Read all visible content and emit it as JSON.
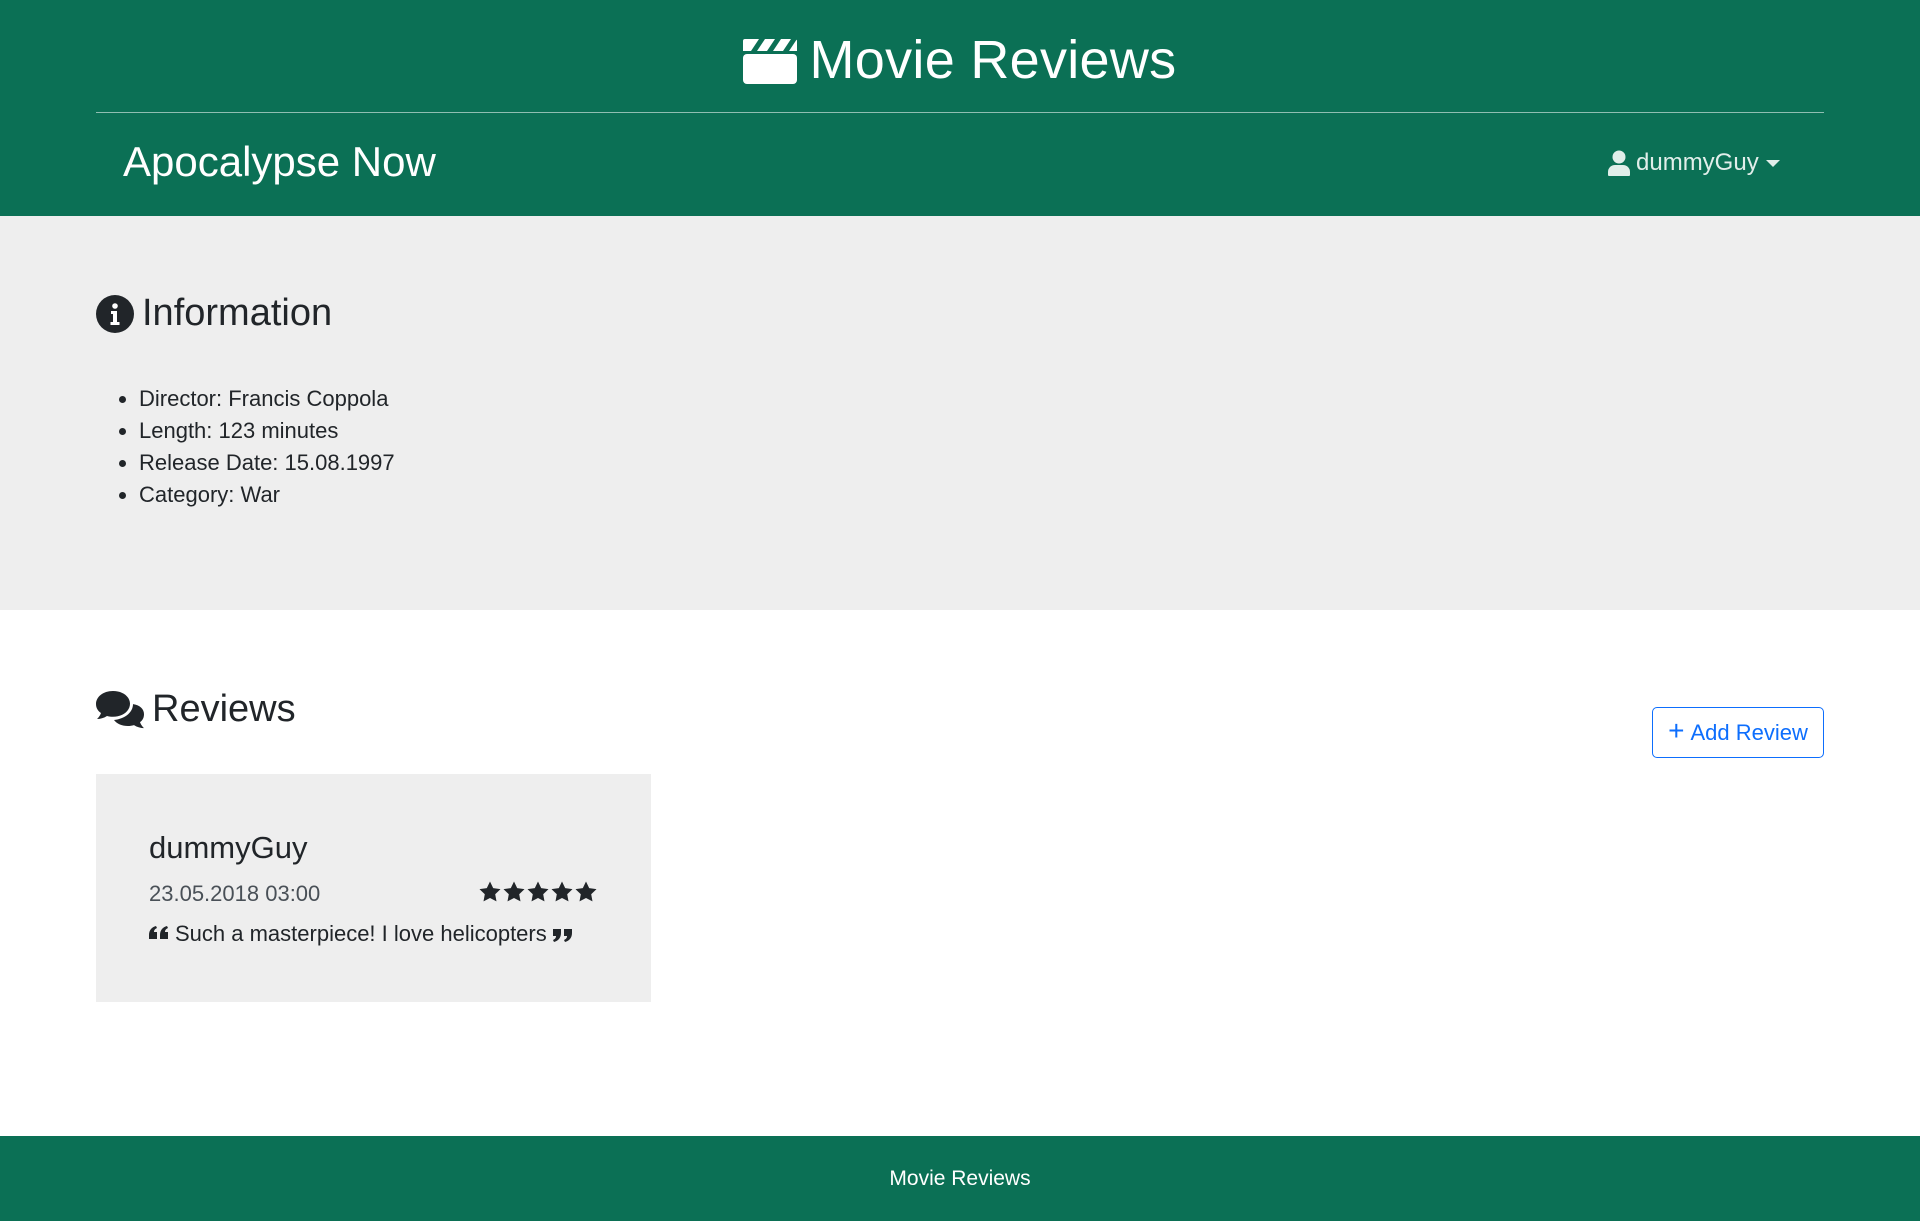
{
  "header": {
    "brand_icon": "clapperboard-icon",
    "brand_title": "Movie Reviews",
    "page_title": "Apocalypse Now",
    "user": {
      "icon": "user-icon",
      "name": "dummyGuy"
    }
  },
  "information": {
    "icon": "info-circle-icon",
    "heading": "Information",
    "items": [
      "Director: Francis Coppola",
      "Length: 123 minutes",
      "Release Date: 15.08.1997",
      "Category: War"
    ]
  },
  "reviews": {
    "icon": "comments-icon",
    "heading": "Reviews",
    "add_button": {
      "icon": "plus-icon",
      "label": "Add Review"
    },
    "items": [
      {
        "author": "dummyGuy",
        "date": "23.05.2018 03:00",
        "rating": 5,
        "rating_max": 5,
        "text": "Such a masterpiece! I love helicopters"
      }
    ]
  },
  "footer": {
    "text": "Movie Reviews"
  },
  "colors": {
    "brand_green": "#0b7055",
    "section_gray": "#eeeeee",
    "primary_blue": "#0d6efd"
  }
}
